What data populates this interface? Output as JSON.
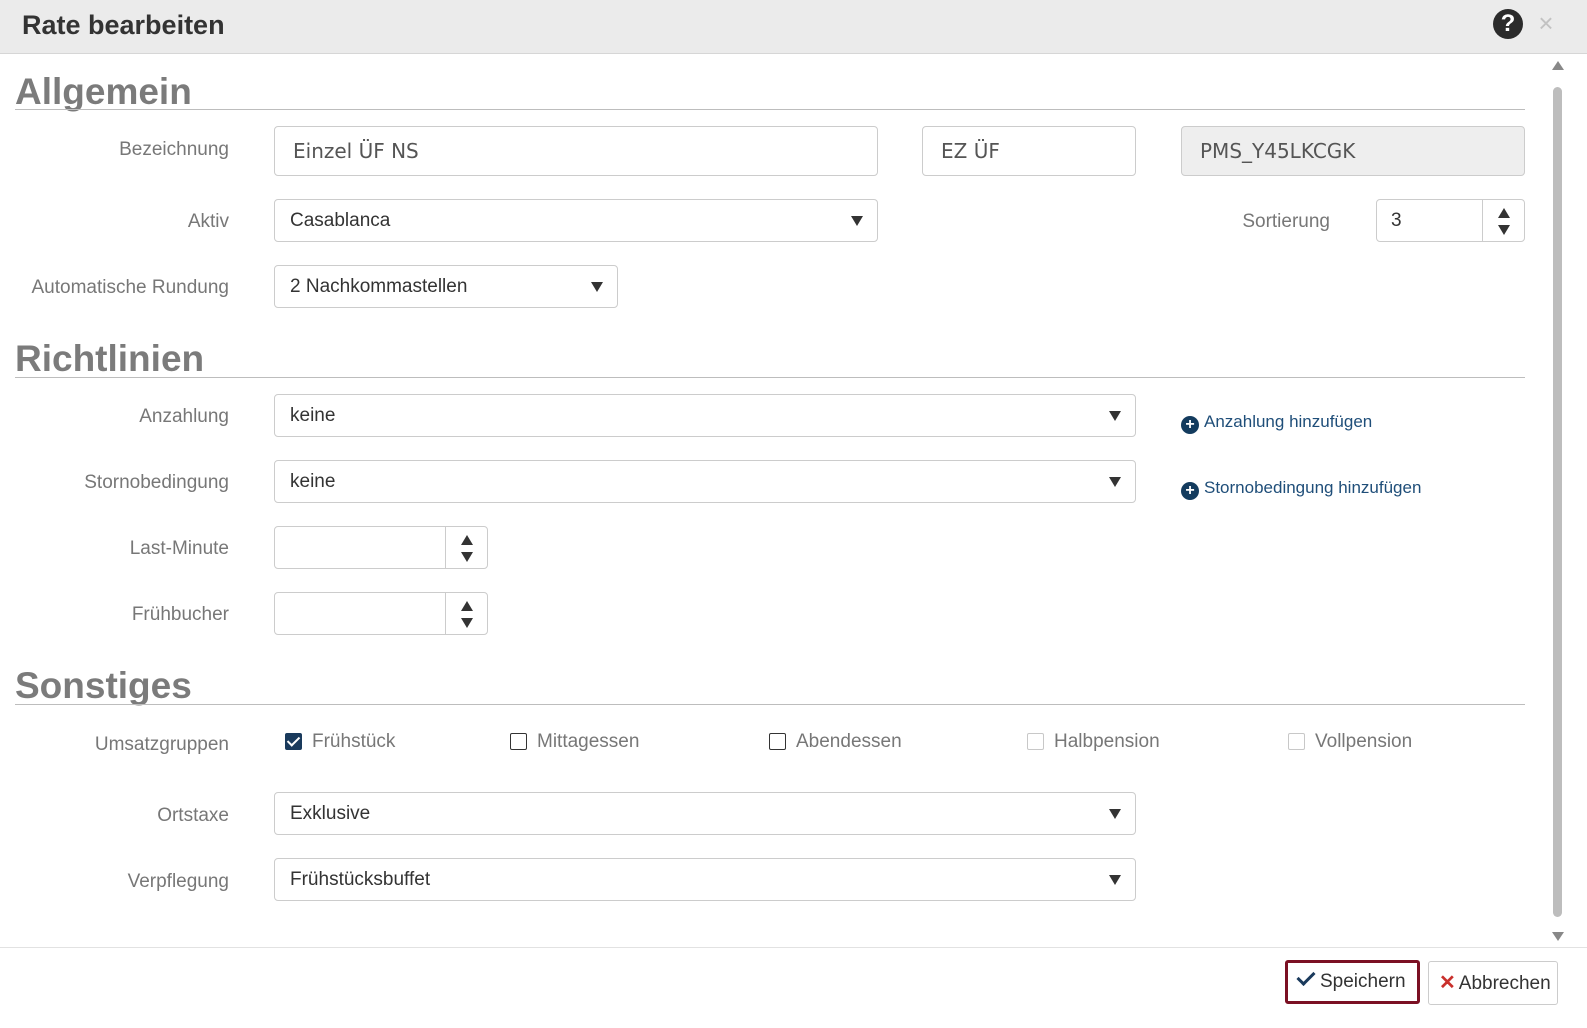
{
  "dialog": {
    "title": "Rate bearbeiten"
  },
  "sections": {
    "general": "Allgemein",
    "policies": "Richtlinien",
    "other": "Sonstiges"
  },
  "general": {
    "name_label": "Bezeichnung",
    "name_value": "Einzel ÜF NS",
    "short_value": "EZ ÜF",
    "code_value": "PMS_Y45LKCGK",
    "active_label": "Aktiv",
    "active_value": "Casablanca",
    "sort_label": "Sortierung",
    "sort_value": "3",
    "rounding_label": "Automatische Rundung",
    "rounding_value": "2 Nachkommastellen"
  },
  "policies": {
    "deposit_label": "Anzahlung",
    "deposit_value": "keine",
    "deposit_add": "Anzahlung hinzufügen",
    "cancel_label": "Stornobedingung",
    "cancel_value": "keine",
    "cancel_add": "Stornobedingung hinzufügen",
    "lastminute_label": "Last-Minute",
    "lastminute_value": "",
    "earlybird_label": "Frühbucher",
    "earlybird_value": ""
  },
  "other": {
    "revenue_label": "Umsatzgruppen",
    "groups": [
      {
        "label": "Frühstück",
        "checked": true,
        "disabled": false
      },
      {
        "label": "Mittagessen",
        "checked": false,
        "disabled": false
      },
      {
        "label": "Abendessen",
        "checked": false,
        "disabled": false
      },
      {
        "label": "Halbpension",
        "checked": false,
        "disabled": true
      },
      {
        "label": "Vollpension",
        "checked": false,
        "disabled": true
      }
    ],
    "tax_label": "Ortstaxe",
    "tax_value": "Exklusive",
    "board_label": "Verpflegung",
    "board_value": "Frühstücksbuffet"
  },
  "footer": {
    "save_label": "Speichern",
    "cancel_label": "Abbrechen"
  },
  "icons": {
    "help": "question-circle-icon",
    "close": "close-icon",
    "add": "plus-circle-icon",
    "save": "check-icon",
    "cancel": "times-icon"
  },
  "colors": {
    "accent": "#1a3a5c",
    "primary_border": "#7b1023",
    "cancel_x": "#c9302c"
  }
}
